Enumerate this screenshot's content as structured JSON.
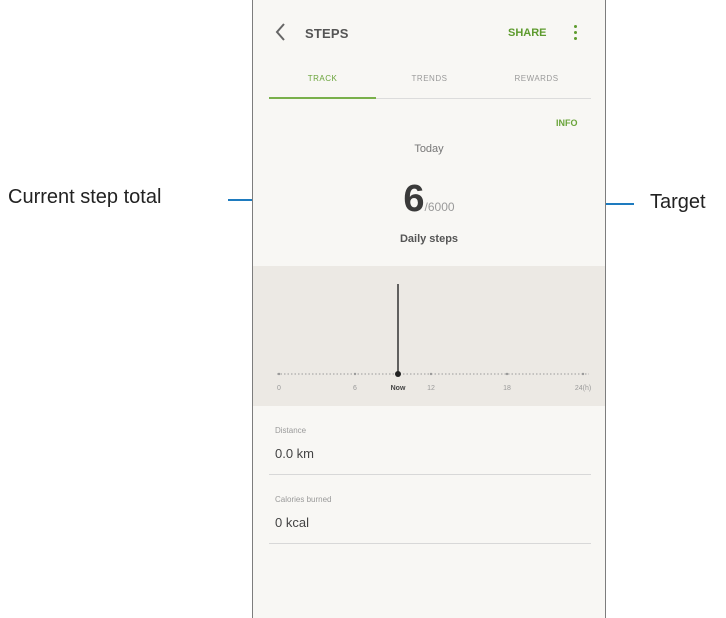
{
  "appbar": {
    "title": "STEPS",
    "share_label": "SHARE"
  },
  "tabs": [
    {
      "label": "TRACK",
      "active": true
    },
    {
      "label": "TRENDS",
      "active": false
    },
    {
      "label": "REWARDS",
      "active": false
    }
  ],
  "track": {
    "info_label": "INFO",
    "day_label": "Today",
    "steps": "6",
    "target": "/6000",
    "caption": "Daily steps"
  },
  "graph": {
    "axis_labels": [
      "0",
      "6",
      "Now",
      "12",
      "18",
      "24(h)"
    ],
    "current_steps": 6,
    "current_label": "Now"
  },
  "stats": [
    {
      "label": "Distance",
      "value": "0.0 km"
    },
    {
      "label": "Calories burned",
      "value": "0 kcal"
    }
  ],
  "annotations": {
    "left_callout": "Current step total",
    "right_callout": "Target"
  },
  "colors": {
    "accent": "#6aa43a",
    "callout_line": "#1e7bbf",
    "graph_bg": "#ece9e4"
  }
}
